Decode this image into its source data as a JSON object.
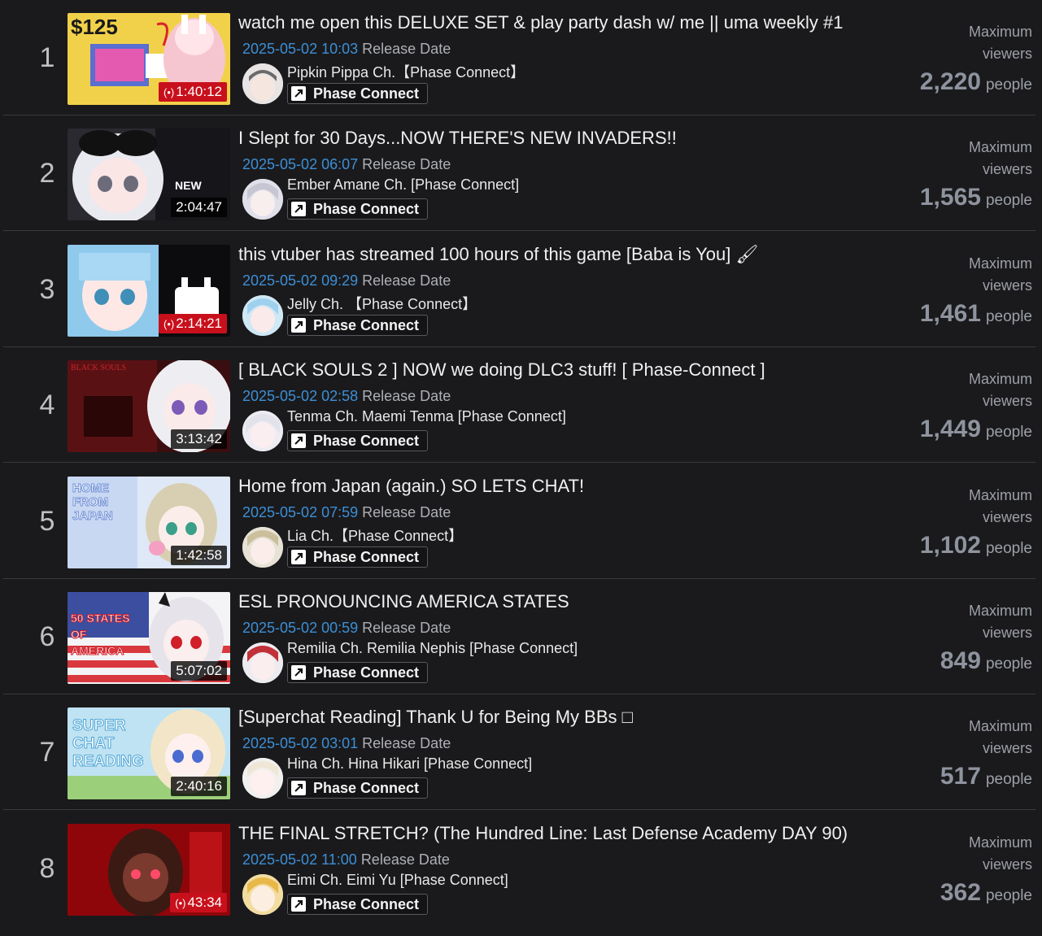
{
  "common": {
    "release_label": "Release Date",
    "max_label_1": "Maximum",
    "max_label_2": "viewers",
    "unit": "people",
    "org_label": "Phase Connect",
    "org_icon": "phase-connect-icon"
  },
  "streams": [
    {
      "rank": "1",
      "title": "watch me open this DELUXE SET & play party dash w/ me || uma weekly #1",
      "date": "2025-05-02 10:03",
      "channel": "Pipkin Pippa Ch.【Phase Connect】",
      "duration": "1:40:12",
      "live": true,
      "viewers": "2,220",
      "thumb_overlay": "$125"
    },
    {
      "rank": "2",
      "title": "I Slept for 30 Days...NOW THERE'S NEW INVADERS!!",
      "date": "2025-05-02 06:07",
      "channel": "Ember Amane Ch. [Phase Connect]",
      "duration": "2:04:47",
      "live": false,
      "viewers": "1,565",
      "thumb_overlay": "NEW"
    },
    {
      "rank": "3",
      "title": "this vtuber has streamed 100 hours of this game [Baba is You] 🖌",
      "date": "2025-05-02 09:29",
      "channel": "Jelly Ch. 【Phase Connect】",
      "duration": "2:14:21",
      "live": true,
      "viewers": "1,461",
      "thumb_overlay": ""
    },
    {
      "rank": "4",
      "title": "[ BLACK SOULS 2 ] NOW we doing DLC3 stuff! [ Phase-Connect ]",
      "date": "2025-05-02 02:58",
      "channel": "Tenma Ch. Maemi Tenma [Phase Connect]",
      "duration": "3:13:42",
      "live": false,
      "viewers": "1,449",
      "thumb_overlay": "BLACK SOULS"
    },
    {
      "rank": "5",
      "title": "Home from Japan (again.) SO LETS CHAT!",
      "date": "2025-05-02 07:59",
      "channel": "Lia Ch.【Phase Connect】",
      "duration": "1:42:58",
      "live": false,
      "viewers": "1,102",
      "thumb_overlay": "HOME FROM JAPAN"
    },
    {
      "rank": "6",
      "title": "ESL PRONOUNCING AMERICA STATES",
      "date": "2025-05-02 00:59",
      "channel": "Remilia Ch. Remilia Nephis [Phase Connect]",
      "duration": "5:07:02",
      "live": false,
      "viewers": "849",
      "thumb_overlay": "50 STATES OF AMERICA"
    },
    {
      "rank": "7",
      "title": "[Superchat Reading] Thank U for Being My BBs □",
      "date": "2025-05-02 03:01",
      "channel": "Hina Ch. Hina Hikari [Phase Connect]",
      "duration": "2:40:16",
      "live": false,
      "viewers": "517",
      "thumb_overlay": "SUPER CHAT READING"
    },
    {
      "rank": "8",
      "title": "THE FINAL STRETCH? (The Hundred Line: Last Defense Academy DAY 90)",
      "date": "2025-05-02 11:00",
      "channel": "Eimi Ch. Eimi Yu [Phase Connect]",
      "duration": "43:34",
      "live": true,
      "viewers": "362",
      "thumb_overlay": ""
    }
  ],
  "colors": {
    "date": "#3d8fd6",
    "live": "#c8101c",
    "background": "#1a1a1c"
  }
}
